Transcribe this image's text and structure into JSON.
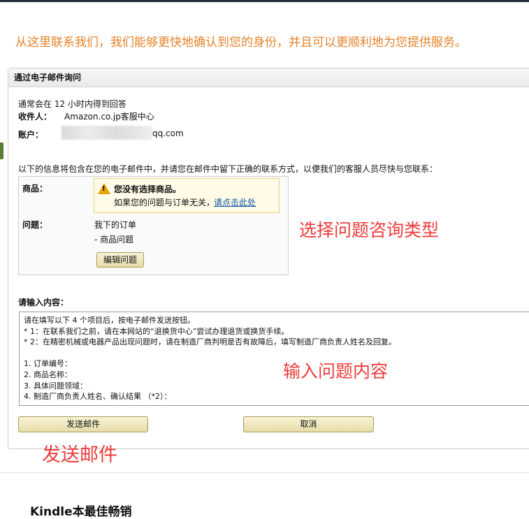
{
  "intro_text": "从这里联系我们，我们能够更快地确认到您的身份，并且可以更顺利地为您提供服务。",
  "panel": {
    "title": "通过电子邮件询问",
    "response_time": "通常会在 12 小时内得到回答",
    "recipient_label": "收件人：",
    "recipient_value": "Amazon.co.jp客服中心",
    "account_label": "账户：",
    "account_value": "qq.com",
    "info_note": "以下的信息将包含在您的电子邮件中，并请您在邮件中留下正确的联系方式，以便我们的客服人员尽快与您联系：",
    "product_label": "商品：",
    "warning_title": "您没有选择商品。",
    "warning_text": "如果您的问题与订单无关，",
    "warning_link": "请点击此处",
    "issue_label": "问题：",
    "issue_line1": "我下的订单",
    "issue_line2": "- 商品问题",
    "edit_button": "编辑问题",
    "content_label": "请输入内容：",
    "content_text": "请在填写以下 4 个项目后，按电子邮件发送按钮。\n* 1：在联系我们之前，请在本网站的“退换货中心”尝试办理退货或换货手续。\n* 2：在精密机械或电器产品出现问题时，请在制造厂商判明是否有故障后，填写制造厂商负责人姓名及回复。\n\n1. 订单编号：\n2. 商品名称：\n3. 具体问题领域：\n4. 制造厂商负责人姓名、确认结果 （*2）：",
    "send_button": "发送邮件",
    "cancel_button": "取消"
  },
  "annotations": {
    "select_type": "选择问题咨询类型",
    "input_content": "输入问题内容",
    "send_mail": "发送邮件"
  },
  "footer_heading": "Kindle本最佳畅销",
  "colors": {
    "intro": "#e4832a",
    "annotation": "#ee3b3b",
    "link": "#0b55a8",
    "button": "#e6dda8"
  },
  "icons": {
    "warning": "warning-triangle-icon"
  }
}
